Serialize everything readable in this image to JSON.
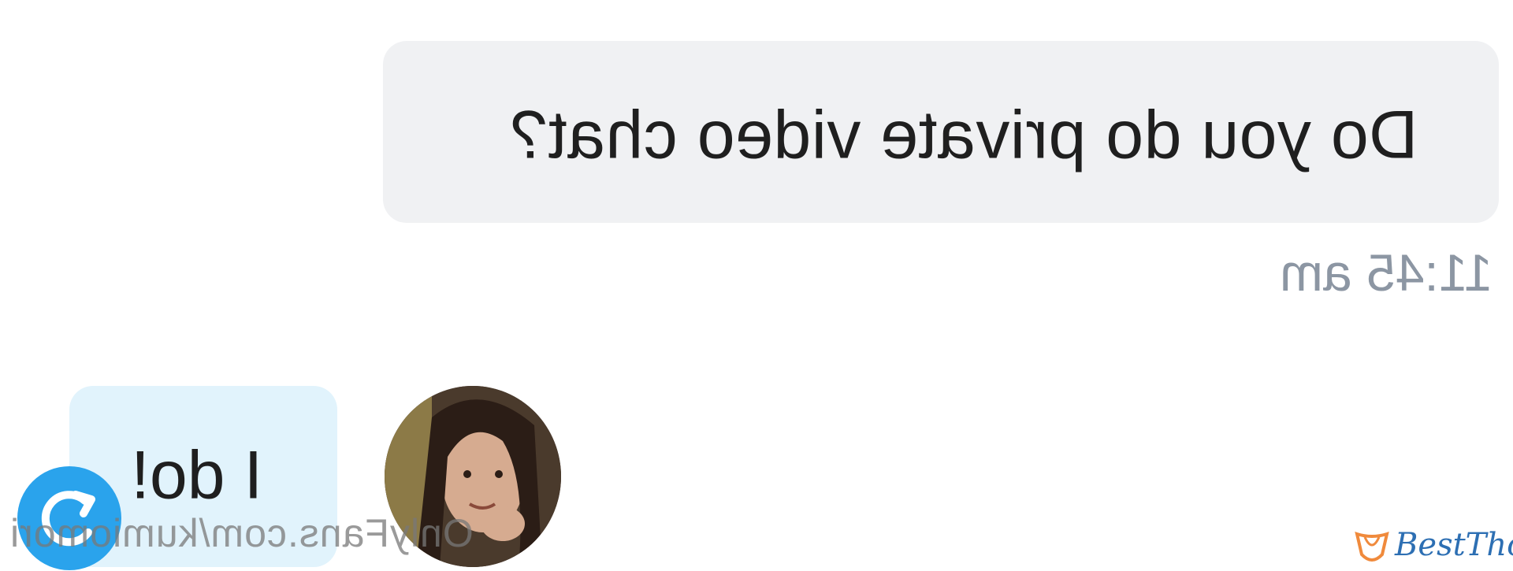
{
  "conversation": {
    "outgoing_message": {
      "text": "Do you do private video chat?",
      "time": "11:45 am"
    },
    "incoming_message": {
      "text": "I do!"
    }
  },
  "watermark": {
    "text": "OnlyFans.com/kumiomori"
  },
  "brand": {
    "logo_text": "BestThot",
    "color": "#2d6fb3"
  },
  "colors": {
    "outgoing_bubble": "#f0f1f3",
    "incoming_bubble": "#e1f3fc",
    "timestamp": "#8c96a3",
    "badge": "#2aa3ec"
  },
  "icons": {
    "badge": "refresh-icon"
  }
}
